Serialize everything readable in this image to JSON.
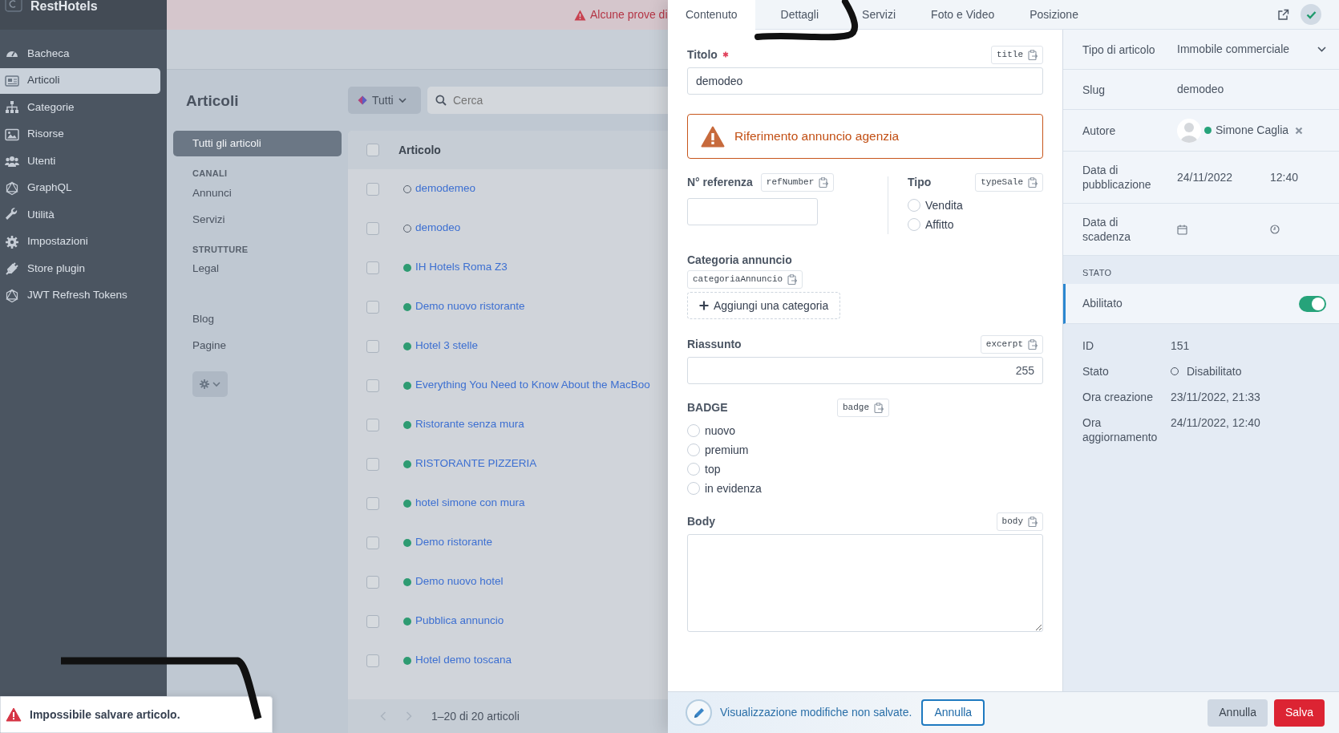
{
  "sidebar": {
    "brand": "RestHotels",
    "items": [
      {
        "label": "Bacheca",
        "selected": false
      },
      {
        "label": "Articoli",
        "selected": true
      },
      {
        "label": "Categorie",
        "selected": false
      },
      {
        "label": "Risorse",
        "selected": false
      },
      {
        "label": "Utenti",
        "selected": false
      },
      {
        "label": "GraphQL",
        "selected": false
      },
      {
        "label": "Utilità",
        "selected": false
      },
      {
        "label": "Impostazioni",
        "selected": false
      },
      {
        "label": "Store plugin",
        "selected": false
      },
      {
        "label": "JWT Refresh Tokens",
        "selected": false
      }
    ]
  },
  "banner": {
    "text": "Alcune prove di"
  },
  "page": {
    "title": "Articoli"
  },
  "subnav": {
    "groups": [
      {
        "items": [
          {
            "label": "Tutti gli articoli",
            "selected": true
          }
        ]
      },
      {
        "title": "CANALI",
        "items": [
          {
            "label": "Annunci",
            "selected": false
          },
          {
            "label": "Servizi",
            "selected": false
          }
        ]
      },
      {
        "title": "STRUTTURE",
        "items": [
          {
            "label": "Legal",
            "selected": false
          }
        ]
      },
      {
        "items": [
          {
            "label": "Blog",
            "selected": false
          },
          {
            "label": "Pagine",
            "selected": false
          }
        ]
      }
    ]
  },
  "filter": {
    "label": "Tutti"
  },
  "search": {
    "placeholder": "Cerca"
  },
  "table": {
    "column": "Articolo",
    "checked": false,
    "rows": [
      {
        "title": "demodemeo",
        "published": false,
        "checked": false
      },
      {
        "title": "demodeo",
        "published": false,
        "checked": false
      },
      {
        "title": "IH Hotels Roma Z3",
        "published": true,
        "checked": false
      },
      {
        "title": "Demo nuovo ristorante",
        "published": true,
        "checked": false
      },
      {
        "title": "Hotel 3 stelle",
        "published": true,
        "checked": false
      },
      {
        "title": "Everything You Need to Know About the MacBoo",
        "published": true,
        "checked": false
      },
      {
        "title": "Ristorante senza mura",
        "published": true,
        "checked": false
      },
      {
        "title": "RISTORANTE PIZZERIA",
        "published": true,
        "checked": false
      },
      {
        "title": "hotel simone con mura",
        "published": true,
        "checked": false
      },
      {
        "title": "Demo ristorante",
        "published": true,
        "checked": false
      },
      {
        "title": "Demo nuovo hotel",
        "published": true,
        "checked": false
      },
      {
        "title": "Pubblica annuncio",
        "published": true,
        "checked": false
      },
      {
        "title": "Hotel demo toscana",
        "published": true,
        "checked": false
      }
    ],
    "footer": "1–20 di 20 articoli"
  },
  "toast": {
    "text": "Impossibile salvare articolo."
  },
  "drawer": {
    "tabs": [
      {
        "label": "Contenuto",
        "selected": true
      },
      {
        "label": "Dettagli",
        "selected": false
      },
      {
        "label": "Servizi",
        "selected": false
      },
      {
        "label": "Foto e Video",
        "selected": false
      },
      {
        "label": "Posizione",
        "selected": false
      }
    ],
    "title_field": {
      "label": "Titolo",
      "required": true,
      "key": "title",
      "value": "demodeo"
    },
    "alert": {
      "text": "Riferimento annuncio agenzia"
    },
    "ref_field": {
      "label": "N° referenza",
      "key": "refNumber"
    },
    "type_field": {
      "label": "Tipo",
      "key": "typeSale",
      "options": [
        {
          "label": "Vendita",
          "selected": false
        },
        {
          "label": "Affitto",
          "selected": false
        }
      ]
    },
    "category_field": {
      "label": "Categoria annuncio",
      "key": "categoriaAnnuncio",
      "button": "Aggiungi una categoria"
    },
    "excerpt_field": {
      "label": "Riassunto",
      "key": "excerpt",
      "counter": "255"
    },
    "badge_field": {
      "label": "BADGE",
      "key": "badge",
      "options": [
        {
          "label": "nuovo",
          "selected": false
        },
        {
          "label": "premium",
          "selected": false
        },
        {
          "label": "top",
          "selected": false
        },
        {
          "label": "in evidenza",
          "selected": false
        }
      ]
    },
    "body_field": {
      "label": "Body",
      "key": "body"
    },
    "details": [
      {
        "kind": "select",
        "label": "Tipo di articolo",
        "value": "Immobile commerciale"
      },
      {
        "kind": "text",
        "label": "Slug",
        "value": "demodeo"
      },
      {
        "kind": "author",
        "label": "Autore",
        "value": "Simone Caglia"
      },
      {
        "kind": "datetime",
        "label": "Data di pubblicazione",
        "date": "24/11/2022",
        "time": "12:40"
      },
      {
        "kind": "datetime",
        "label": "Data di scadenza"
      }
    ],
    "status": {
      "title": "STATO",
      "toggle": {
        "label": "Abilitato",
        "on": true
      }
    },
    "info": [
      {
        "kind": "text",
        "label": "ID",
        "value": "151"
      },
      {
        "kind": "status",
        "label": "Stato",
        "value": "Disabilitato"
      },
      {
        "kind": "text",
        "label": "Ora creazione",
        "value": "23/11/2022, 21:33"
      },
      {
        "kind": "text",
        "label": "Ora aggiornamento",
        "value": "24/11/2022, 12:40"
      }
    ],
    "footer": {
      "message": "Visualizzazione modifiche non salvate.",
      "undo": "Annulla",
      "cancel": "Annulla",
      "save": "Salva"
    }
  }
}
